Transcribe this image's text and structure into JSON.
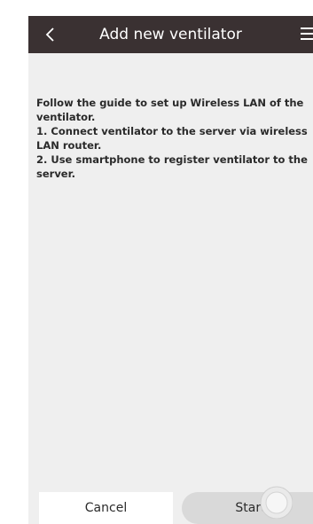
{
  "header": {
    "title": "Add new ventilator",
    "back_icon": "chevron-left-icon",
    "menu_icon": "hamburger-menu-icon",
    "background": "#3a3132"
  },
  "main": {
    "instructions": "Follow the guide to set up Wireless LAN of the ventilator.\n1. Connect ventilator to the server via wireless LAN router.\n2. Use smartphone to register ventilator to the server."
  },
  "footer": {
    "cancel_label": "Cancel",
    "start_label": "Start"
  }
}
